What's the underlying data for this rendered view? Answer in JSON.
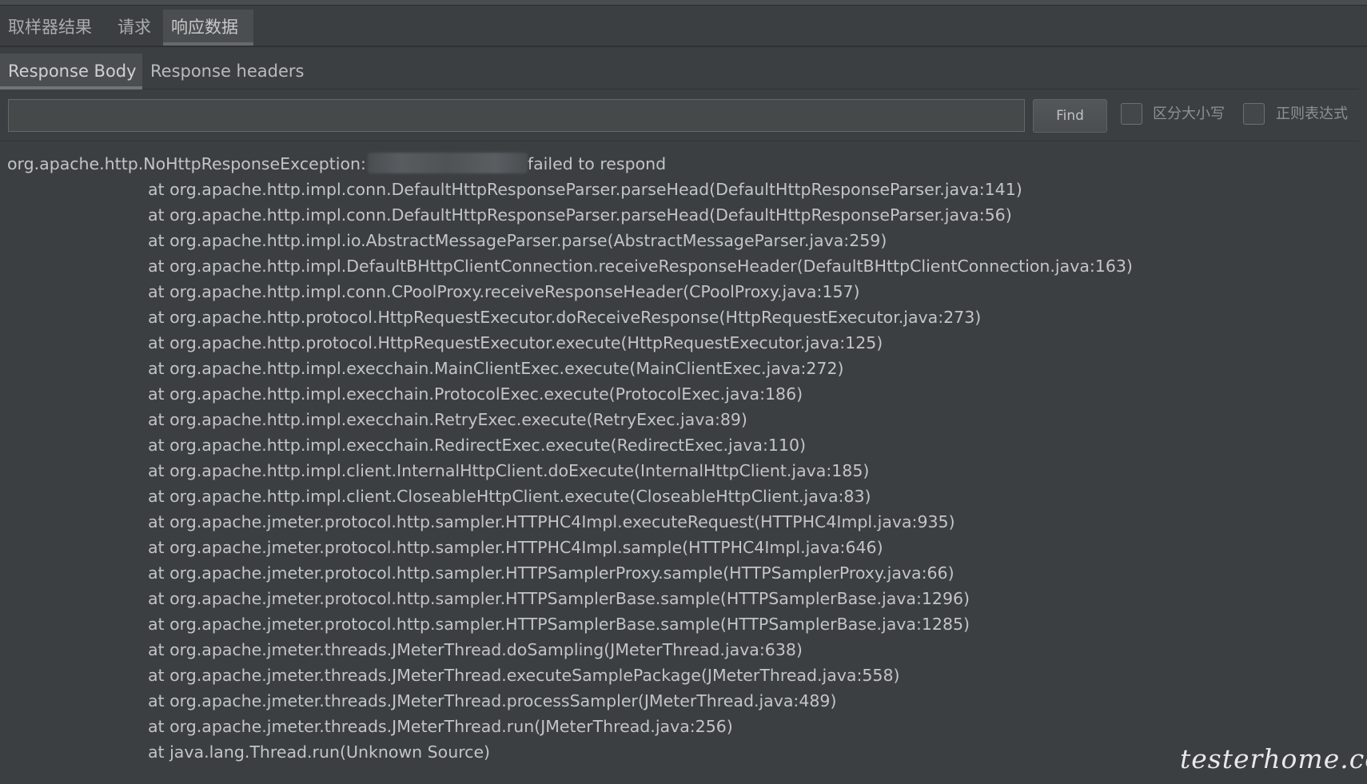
{
  "tabs_main": [
    "取样器结果",
    "请求",
    "响应数据"
  ],
  "tabs_sub": [
    "Response Body",
    "Response headers"
  ],
  "search": {
    "value": "",
    "placeholder": "",
    "find_label": "Find",
    "case_sensitive_label": "区分大小写",
    "regex_label": "正则表达式"
  },
  "response": {
    "exception_prefix": "org.apache.http.NoHttpResponseException:",
    "exception_suffix": "failed to respond",
    "stack": [
      "at org.apache.http.impl.conn.DefaultHttpResponseParser.parseHead(DefaultHttpResponseParser.java:141)",
      "at org.apache.http.impl.conn.DefaultHttpResponseParser.parseHead(DefaultHttpResponseParser.java:56)",
      "at org.apache.http.impl.io.AbstractMessageParser.parse(AbstractMessageParser.java:259)",
      "at org.apache.http.impl.DefaultBHttpClientConnection.receiveResponseHeader(DefaultBHttpClientConnection.java:163)",
      "at org.apache.http.impl.conn.CPoolProxy.receiveResponseHeader(CPoolProxy.java:157)",
      "at org.apache.http.protocol.HttpRequestExecutor.doReceiveResponse(HttpRequestExecutor.java:273)",
      "at org.apache.http.protocol.HttpRequestExecutor.execute(HttpRequestExecutor.java:125)",
      "at org.apache.http.impl.execchain.MainClientExec.execute(MainClientExec.java:272)",
      "at org.apache.http.impl.execchain.ProtocolExec.execute(ProtocolExec.java:186)",
      "at org.apache.http.impl.execchain.RetryExec.execute(RetryExec.java:89)",
      "at org.apache.http.impl.execchain.RedirectExec.execute(RedirectExec.java:110)",
      "at org.apache.http.impl.client.InternalHttpClient.doExecute(InternalHttpClient.java:185)",
      "at org.apache.http.impl.client.CloseableHttpClient.execute(CloseableHttpClient.java:83)",
      "at org.apache.jmeter.protocol.http.sampler.HTTPHC4Impl.executeRequest(HTTPHC4Impl.java:935)",
      "at org.apache.jmeter.protocol.http.sampler.HTTPHC4Impl.sample(HTTPHC4Impl.java:646)",
      "at org.apache.jmeter.protocol.http.sampler.HTTPSamplerProxy.sample(HTTPSamplerProxy.java:66)",
      "at org.apache.jmeter.protocol.http.sampler.HTTPSamplerBase.sample(HTTPSamplerBase.java:1296)",
      "at org.apache.jmeter.protocol.http.sampler.HTTPSamplerBase.sample(HTTPSamplerBase.java:1285)",
      "at org.apache.jmeter.threads.JMeterThread.doSampling(JMeterThread.java:638)",
      "at org.apache.jmeter.threads.JMeterThread.executeSamplePackage(JMeterThread.java:558)",
      "at org.apache.jmeter.threads.JMeterThread.processSampler(JMeterThread.java:489)",
      "at org.apache.jmeter.threads.JMeterThread.run(JMeterThread.java:256)",
      "at java.lang.Thread.run(Unknown Source)"
    ]
  },
  "watermark": "testerhome.com"
}
